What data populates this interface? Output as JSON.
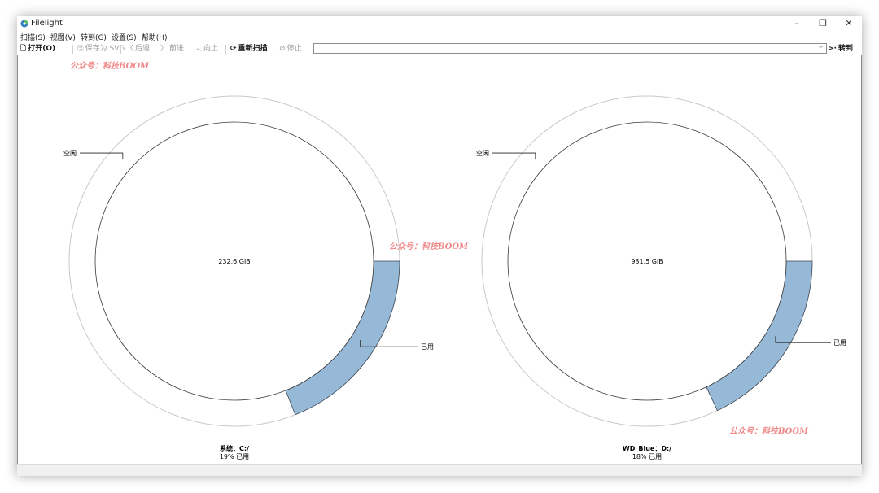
{
  "window": {
    "title": "Filelight",
    "minimize_glyph": "–",
    "restore_glyph": "❐",
    "close_glyph": "✕"
  },
  "menu": {
    "items": [
      "扫描(S)",
      "视图(V)",
      "转到(G)",
      "设置(S)",
      "帮助(H)"
    ]
  },
  "toolbar": {
    "open": "打开(O)",
    "save_svg": "保存为 SVG",
    "back": "后退",
    "forward": "前进",
    "up": "向上",
    "rescan": "重新扫描",
    "stop": "停止",
    "path_value": "",
    "go": "转到"
  },
  "icons": {
    "open": "document-open-icon",
    "save": "save-icon",
    "back": "chevron-left-icon",
    "forward": "chevron-right-icon",
    "up": "chevron-up-icon",
    "rescan": "refresh-icon",
    "stop": "stop-icon",
    "dropdown": "chevron-down-icon",
    "go": "go-arrow-icon"
  },
  "colors": {
    "used_segment": "#97b9d8",
    "ring_outline": "#c9c9c9",
    "watermark": "#f08a8a"
  },
  "watermark_text": "公众号：科技BOOM",
  "disks": [
    {
      "total": "232.6 GiB",
      "name": "系统：C:/",
      "usage": "19% 已用",
      "used_fraction": 0.19,
      "free_label": "空闲",
      "used_label": "已用"
    },
    {
      "total": "931.5 GiB",
      "name": "WD_Blue：D:/",
      "usage": "18% 已用",
      "used_fraction": 0.18,
      "free_label": "空闲",
      "used_label": "已用"
    }
  ]
}
